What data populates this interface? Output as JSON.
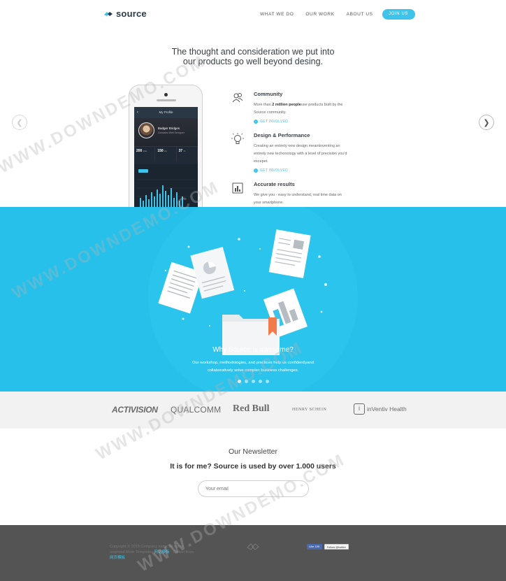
{
  "header": {
    "logo_text": "source",
    "nav": [
      "WHAT WE DO",
      "OUR WORK",
      "ABOUT US"
    ],
    "join_label": "JOIN US"
  },
  "hero": {
    "title_line1": "The thought and consideration we put into",
    "title_line2": "our products go well beyond desing."
  },
  "phone": {
    "screen_title": "My Profile",
    "user_name": "Badger Bridges",
    "user_sub": "Gonzalez Web Designer",
    "stats": [
      {
        "value": "200",
        "unit": "kcal"
      },
      {
        "value": "150",
        "unit": "km"
      },
      {
        "value": "37",
        "unit": "%"
      }
    ]
  },
  "features": [
    {
      "icon": "users-icon",
      "title": "Community",
      "text_pre": "More than ",
      "text_bold": "2 million people",
      "text_post": "use products built by the Source community.",
      "link": "GET INVOLVED"
    },
    {
      "icon": "lightbulb-icon",
      "title": "Design & Performance",
      "text": "Creating an entirely new design meantinventing an entirely new techonology with a level of precision you'd excepet.",
      "link": "GET INVOLVED"
    },
    {
      "icon": "chart-icon",
      "title": "Accurate results",
      "text": "We give you - easy to understand, real time data on your smartphone."
    }
  ],
  "band": {
    "title": "Why Source is awesome?",
    "text_line1": "Our workshop, methodologies, and practices help us confidentlyand",
    "text_line2": "collaboratively solve complex business challenges.",
    "slides": 5,
    "active_slide": 0,
    "bg_color": "#27c0ea"
  },
  "clients": [
    "ACTIVISION",
    "QUALCOMM",
    "Red Bull",
    "HENRY SCHEIN",
    "inVentiv Health"
  ],
  "newsletter": {
    "title": "Our Newsletter",
    "subtitle": "It is for me? Source is used by over 1.000 users",
    "email_placeholder": "Your email"
  },
  "footer": {
    "copy_line1": "Copyright © 2015 Company name All rights",
    "copy_line2": "reserved.More Templates",
    "copy_link1": "网站模板",
    "copy_line3": "- Collect from",
    "copy_link2": "网页模板",
    "like_label": "Like 10K",
    "follow_label": "Follow @twitter"
  },
  "watermark": "WWW.DOWNDEMO.COM"
}
